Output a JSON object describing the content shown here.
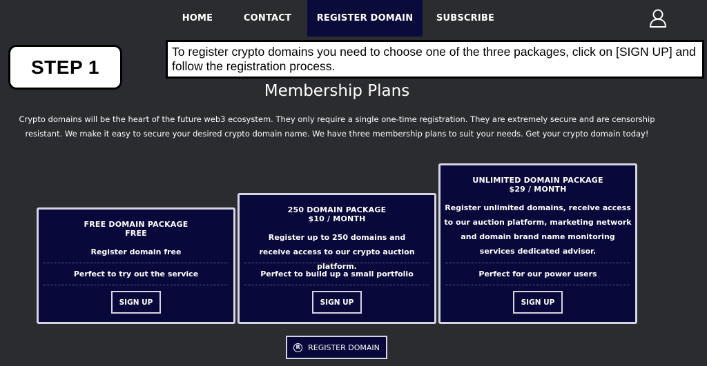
{
  "nav": {
    "home": "HOME",
    "contact": "CONTACT",
    "register_domain": "REGISTER DOMAIN",
    "subscribe": "SUBSCRIBE",
    "user_icon": "user-icon"
  },
  "step": {
    "label": "STEP 1",
    "instruction": "To register crypto domains you need to choose one of the three packages, click on [SIGN UP] and follow the registration process."
  },
  "page": {
    "title": "Membership Plans",
    "intro": "Crypto domains will be the heart of the future web3 ecosystem. They only require a single one-time registration. They are extremely secure and are censorship resistant. We make it easy to secure your desired crypto domain name. We have three membership plans to suit your needs. Get your crypto domain today!"
  },
  "plans": [
    {
      "name": "FREE DOMAIN PACKAGE",
      "price": "FREE",
      "description": "Register domain free",
      "feature": "Perfect to try out the service",
      "button": "SIGN UP"
    },
    {
      "name": "250 DOMAIN PACKAGE",
      "price": "$10 / MONTH",
      "description": "Register up to 250 domains and receive access to our crypto auction platform.",
      "feature": "Perfect to build up a small portfolio",
      "button": "SIGN UP"
    },
    {
      "name": "UNLIMITED DOMAIN PACKAGE",
      "price": "$29 / MONTH",
      "description": "Register unlimited domains, receive access to our auction platform, marketing network and domain brand name monitoring services dedicated advisor.",
      "feature": "Perfect for our power users",
      "button": "SIGN UP"
    }
  ],
  "footer_button": {
    "label": "REGISTER DOMAIN",
    "icon": "registered-icon",
    "icon_glyph": "R"
  },
  "colors": {
    "background": "#2b2c2f",
    "nav_active": "#0b0b3b",
    "card_bg": "#08083a",
    "card_border": "#d5d5e3"
  }
}
